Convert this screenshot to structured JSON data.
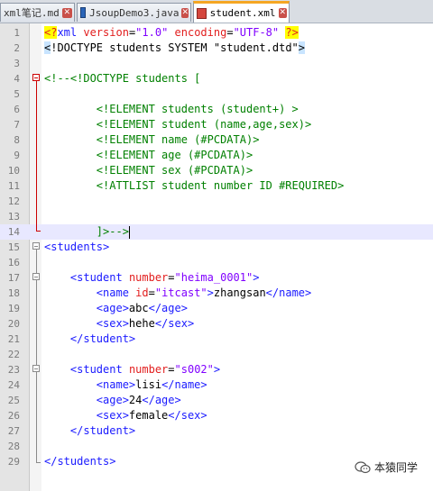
{
  "tabs": [
    {
      "label": "xml笔记.md",
      "icon": "markdown-file-icon"
    },
    {
      "label": "JsoupDemo3.java",
      "icon": "java-file-icon"
    },
    {
      "label": "student.xml",
      "icon": "xml-file-icon",
      "active": true
    }
  ],
  "close_glyph": "✕",
  "lines": [
    {
      "n": "1",
      "tokens": [
        {
          "c": "pi",
          "t": "<?"
        },
        {
          "c": "tag",
          "t": "xml "
        },
        {
          "c": "attr",
          "t": "version"
        },
        {
          "c": "txt",
          "t": "="
        },
        {
          "c": "val",
          "t": "\"1.0\""
        },
        {
          "c": "txt",
          "t": " "
        },
        {
          "c": "attr",
          "t": "encoding"
        },
        {
          "c": "txt",
          "t": "="
        },
        {
          "c": "val",
          "t": "\"UTF-8\""
        },
        {
          "c": "txt",
          "t": " "
        },
        {
          "c": "pi",
          "t": "?>"
        }
      ]
    },
    {
      "n": "2",
      "tokens": [
        {
          "c": "dt",
          "t": "<"
        },
        {
          "c": "txt",
          "t": "!DOCTYPE students SYSTEM \"student.dtd\""
        },
        {
          "c": "dt",
          "t": ">"
        }
      ]
    },
    {
      "n": "3",
      "tokens": []
    },
    {
      "n": "4",
      "tokens": [
        {
          "c": "com",
          "t": "<!--<!DOCTYPE students ["
        }
      ]
    },
    {
      "n": "5",
      "tokens": []
    },
    {
      "n": "6",
      "tokens": [
        {
          "c": "com",
          "t": "        <!ELEMENT students (student+) >"
        }
      ]
    },
    {
      "n": "7",
      "tokens": [
        {
          "c": "com",
          "t": "        <!ELEMENT student (name,age,sex)>"
        }
      ]
    },
    {
      "n": "8",
      "tokens": [
        {
          "c": "com",
          "t": "        <!ELEMENT name (#PCDATA)>"
        }
      ]
    },
    {
      "n": "9",
      "tokens": [
        {
          "c": "com",
          "t": "        <!ELEMENT age (#PCDATA)>"
        }
      ]
    },
    {
      "n": "10",
      "tokens": [
        {
          "c": "com",
          "t": "        <!ELEMENT sex (#PCDATA)>"
        }
      ]
    },
    {
      "n": "11",
      "tokens": [
        {
          "c": "com",
          "t": "        <!ATTLIST student number ID #REQUIRED>"
        }
      ]
    },
    {
      "n": "12",
      "tokens": []
    },
    {
      "n": "13",
      "tokens": []
    },
    {
      "n": "14",
      "tokens": [
        {
          "c": "com",
          "t": "        ]>-->"
        }
      ],
      "current": true,
      "caret": true
    },
    {
      "n": "15",
      "tokens": [
        {
          "c": "tag",
          "t": "<students>"
        }
      ]
    },
    {
      "n": "16",
      "tokens": []
    },
    {
      "n": "17",
      "tokens": [
        {
          "c": "txt",
          "t": "    "
        },
        {
          "c": "tag",
          "t": "<student "
        },
        {
          "c": "attr",
          "t": "number"
        },
        {
          "c": "txt",
          "t": "="
        },
        {
          "c": "val",
          "t": "\"heima_0001\""
        },
        {
          "c": "tag",
          "t": ">"
        }
      ]
    },
    {
      "n": "18",
      "tokens": [
        {
          "c": "txt",
          "t": "        "
        },
        {
          "c": "tag",
          "t": "<name "
        },
        {
          "c": "attr",
          "t": "id"
        },
        {
          "c": "txt",
          "t": "="
        },
        {
          "c": "val",
          "t": "\"itcast\""
        },
        {
          "c": "tag",
          "t": ">"
        },
        {
          "c": "txt",
          "t": "zhangsan"
        },
        {
          "c": "tag",
          "t": "</name>"
        }
      ]
    },
    {
      "n": "19",
      "tokens": [
        {
          "c": "txt",
          "t": "        "
        },
        {
          "c": "tag",
          "t": "<age>"
        },
        {
          "c": "txt",
          "t": "abc"
        },
        {
          "c": "tag",
          "t": "</age>"
        }
      ]
    },
    {
      "n": "20",
      "tokens": [
        {
          "c": "txt",
          "t": "        "
        },
        {
          "c": "tag",
          "t": "<sex>"
        },
        {
          "c": "txt",
          "t": "hehe"
        },
        {
          "c": "tag",
          "t": "</sex>"
        }
      ]
    },
    {
      "n": "21",
      "tokens": [
        {
          "c": "txt",
          "t": "    "
        },
        {
          "c": "tag",
          "t": "</student>"
        }
      ]
    },
    {
      "n": "22",
      "tokens": []
    },
    {
      "n": "23",
      "tokens": [
        {
          "c": "txt",
          "t": "    "
        },
        {
          "c": "tag",
          "t": "<student "
        },
        {
          "c": "attr",
          "t": "number"
        },
        {
          "c": "txt",
          "t": "="
        },
        {
          "c": "val",
          "t": "\"s002\""
        },
        {
          "c": "tag",
          "t": ">"
        }
      ]
    },
    {
      "n": "24",
      "tokens": [
        {
          "c": "txt",
          "t": "        "
        },
        {
          "c": "tag",
          "t": "<name>"
        },
        {
          "c": "txt",
          "t": "lisi"
        },
        {
          "c": "tag",
          "t": "</name>"
        }
      ]
    },
    {
      "n": "25",
      "tokens": [
        {
          "c": "txt",
          "t": "        "
        },
        {
          "c": "tag",
          "t": "<age>"
        },
        {
          "c": "txt",
          "t": "24"
        },
        {
          "c": "tag",
          "t": "</age>"
        }
      ]
    },
    {
      "n": "26",
      "tokens": [
        {
          "c": "txt",
          "t": "        "
        },
        {
          "c": "tag",
          "t": "<sex>"
        },
        {
          "c": "txt",
          "t": "female"
        },
        {
          "c": "tag",
          "t": "</sex>"
        }
      ]
    },
    {
      "n": "27",
      "tokens": [
        {
          "c": "txt",
          "t": "    "
        },
        {
          "c": "tag",
          "t": "</student>"
        }
      ]
    },
    {
      "n": "28",
      "tokens": []
    },
    {
      "n": "29",
      "tokens": [
        {
          "c": "tag",
          "t": "</students>"
        }
      ]
    }
  ],
  "watermark": {
    "text": "本猿同学",
    "icon": "wechat-official-account-icon"
  }
}
